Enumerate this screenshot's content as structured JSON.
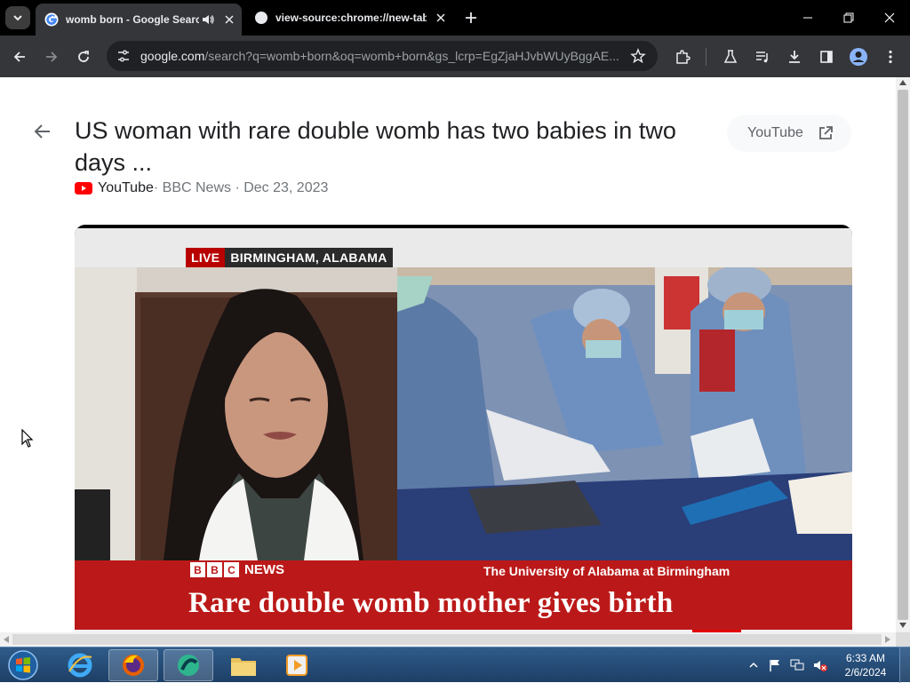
{
  "browser": {
    "tabs": [
      {
        "title": "womb born - Google Search",
        "active": true,
        "favicon": "google-g-icon",
        "audio": true
      },
      {
        "title": "view-source:chrome://new-tab-page",
        "active": false,
        "favicon": "globe-icon",
        "audio": false
      }
    ],
    "address": {
      "host": "google.com",
      "path": "/search?q=womb+born&oq=womb+born&gs_lcrp=EgZjaHJvbWUyBggAE..."
    }
  },
  "result": {
    "title": "US woman with rare double womb has two babies in two days ...",
    "source_site": "YouTube",
    "source_meta": " · BBC News · Dec 23, 2023",
    "chip_label": "YouTube"
  },
  "video": {
    "live_label": "LIVE",
    "location": "BIRMINGHAM, ALABAMA",
    "bbc_letters": [
      "B",
      "B",
      "C"
    ],
    "news_label": "NEWS",
    "credit": "The University of Alabama at Birmingham",
    "headline": "Rare double womb mother gives birth"
  },
  "taskbar": {
    "apps": [
      "internet-explorer-icon",
      "firefox-icon",
      "generic-app-icon",
      "file-explorer-icon",
      "media-player-icon"
    ],
    "time": "6:33 AM",
    "date": "2/6/2024"
  },
  "colors": {
    "bbc_red": "#bb1919",
    "chrome_dark": "#35363a",
    "live_red": "#b80000"
  }
}
